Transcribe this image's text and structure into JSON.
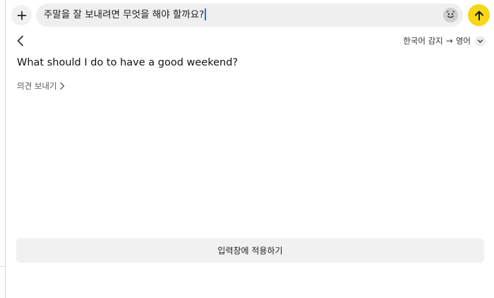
{
  "composer": {
    "input_text": "주말을 잘 보내려면 무엇을 해야 할까요?",
    "send_color": "#f7d716"
  },
  "translator": {
    "source_lang": "한국어 감지",
    "arrow": "→",
    "target_lang": "영어",
    "result_text": "What should I do to have a good weekend?",
    "feedback_label": "의견 보내기",
    "apply_label": "입력창에 적용하기"
  }
}
